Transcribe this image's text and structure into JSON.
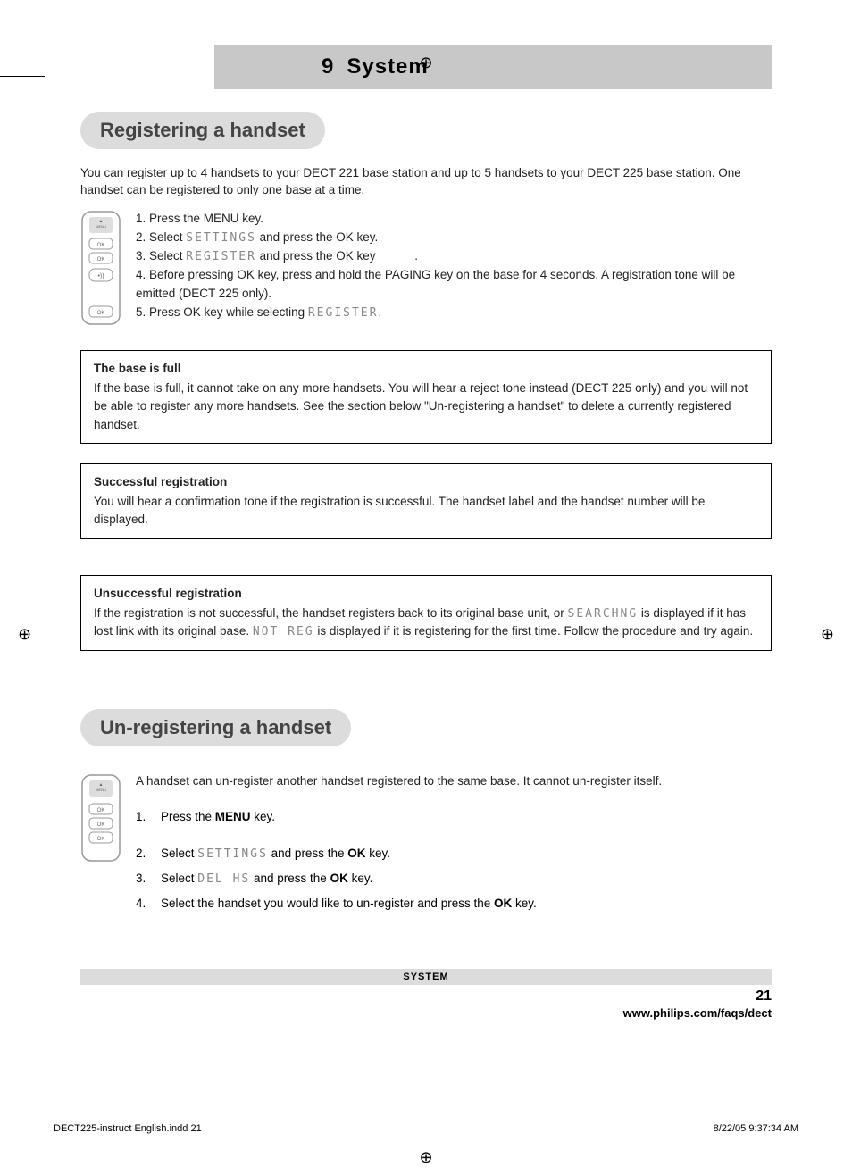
{
  "chapter": {
    "number": "9",
    "title": "System"
  },
  "section1": {
    "heading": "Registering a handset",
    "intro": "You can register up to 4 handsets to your DECT 221 base station and up to 5 handsets to your DECT 225 base station. One handset can be registered to only one base at a time.",
    "steps": {
      "s1": "1. Press the MENU key.",
      "s2a": "2. Select ",
      "s2lcd": "SETTINGS",
      "s2b": " and press the OK key.",
      "s3a": "3. Select ",
      "s3lcd": "REGISTER",
      "s3b": " and press the OK key",
      "s3c": ".",
      "s4": "4. Before pressing OK key, press and hold the PAGING key on the base for 4 seconds.  A registration tone will be emitted (DECT 225 only).",
      "s5a": "5. Press OK key while selecting ",
      "s5lcd": "REGISTER",
      "s5b": "."
    }
  },
  "box1": {
    "title": "The base is full",
    "body": "If the base is full, it cannot take on any more handsets.  You will hear a reject tone instead (DECT 225 only) and you will not be able to register any more handsets. See the section below \"Un-registering a handset\" to delete a currently registered handset."
  },
  "box2": {
    "title": "Successful registration",
    "body": "You will hear a confirmation tone if the registration is successful.  The handset label and the handset number will be displayed."
  },
  "box3": {
    "title": "Unsuccessful registration",
    "body1": "If the registration is not successful, the handset registers back to its original base unit, or ",
    "lcd1": "SEARCHNG",
    "body2": " is displayed if it has lost link with its original base.  ",
    "lcd2": "NOT REG",
    "body3": " is displayed if it is registering for the first time. Follow the procedure and try again."
  },
  "section2": {
    "heading": "Un-registering a handset",
    "intro": "A handset can un-register another handset registered to the same base.  It cannot un-register itself.",
    "items": {
      "n1": "1.",
      "t1a": "Press the ",
      "t1b": "MENU",
      "t1c": " key.",
      "n2": "2.",
      "t2a": "Select ",
      "t2lcd": "SETTINGS",
      "t2b": " and press the ",
      "t2c": "OK",
      "t2d": " key.",
      "n3": "3.",
      "t3a": "Select ",
      "t3lcd": "DEL HS",
      "t3b": " and press the ",
      "t3c": "OK",
      "t3d": " key.",
      "n4": "4.",
      "t4a": "Select the handset you would like to un-register and press the ",
      "t4b": "OK",
      "t4c": " key."
    }
  },
  "footer": {
    "label": "SYSTEM",
    "page": "21",
    "url": "www.philips.com/faqs/dect"
  },
  "imprint": {
    "file": "DECT225-instruct English.indd   21",
    "date": "8/22/05   9:37:34 AM"
  }
}
